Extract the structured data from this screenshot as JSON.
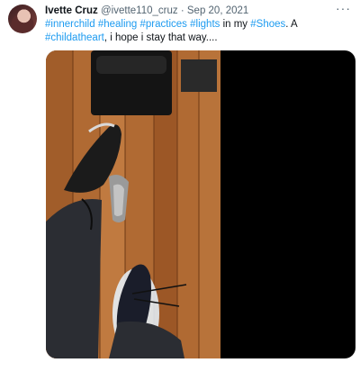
{
  "tweet": {
    "author_name": "Ivette Cruz",
    "handle": "@ivette110_cruz",
    "separator": "·",
    "date": "Sep 20, 2021",
    "more_label": "···",
    "text_parts": [
      {
        "text": "#innerchild",
        "type": "hashtag"
      },
      {
        "text": " ",
        "type": "text"
      },
      {
        "text": "#healing",
        "type": "hashtag"
      },
      {
        "text": "  ",
        "type": "text"
      },
      {
        "text": "#practices",
        "type": "hashtag"
      },
      {
        "text": " ",
        "type": "text"
      },
      {
        "text": "#lights",
        "type": "hashtag"
      },
      {
        "text": " in my ",
        "type": "text"
      },
      {
        "text": "#Shoes",
        "type": "hashtag"
      },
      {
        "text": ". A ",
        "type": "text"
      },
      {
        "text": "#childatheart",
        "type": "hashtag"
      },
      {
        "text": ", i hope i stay that way....",
        "type": "text"
      }
    ],
    "media": {
      "kind": "video",
      "description_icon": "video-frame-shoes"
    }
  },
  "colors": {
    "link": "#1d9bf0",
    "muted": "#536471",
    "text": "#0f1419"
  }
}
